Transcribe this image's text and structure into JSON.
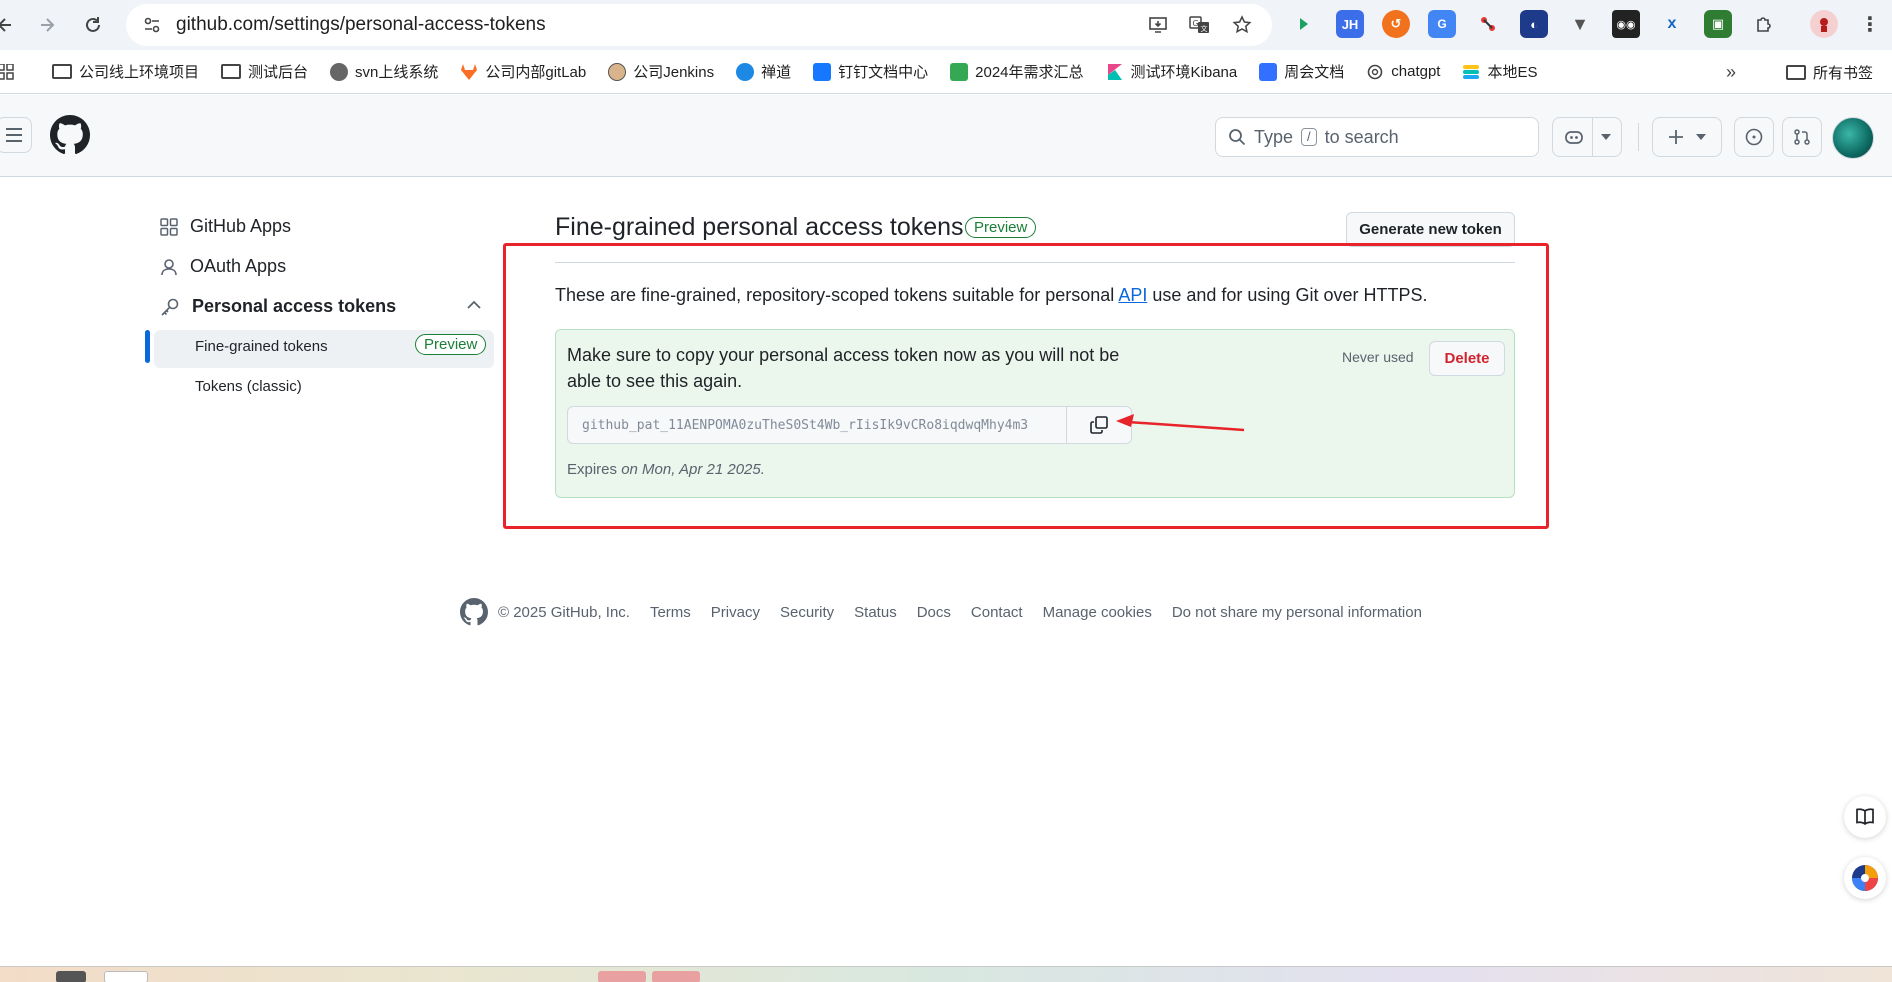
{
  "browser": {
    "url": "github.com/settings/personal-access-tokens",
    "bookmarks": [
      {
        "label": "公司线上环境项目",
        "icon": "folder-icon"
      },
      {
        "label": "测试后台",
        "icon": "folder-icon"
      },
      {
        "label": "svn上线系统",
        "icon": "svn-icon"
      },
      {
        "label": "公司内部gitLab",
        "icon": "gitlab-icon"
      },
      {
        "label": "公司Jenkins",
        "icon": "jenkins-icon"
      },
      {
        "label": "禅道",
        "icon": "zentao-icon"
      },
      {
        "label": "钉钉文档中心",
        "icon": "dingtalk-icon"
      },
      {
        "label": "2024年需求汇总",
        "icon": "sheet-icon"
      },
      {
        "label": "测试环境Kibana",
        "icon": "kibana-icon"
      },
      {
        "label": "周会文档",
        "icon": "doc-icon"
      },
      {
        "label": "chatgpt",
        "icon": "openai-icon"
      },
      {
        "label": "本地ES",
        "icon": "elastic-icon"
      }
    ],
    "all_bookmarks_label": "所有书签",
    "extension_icons": [
      "ext-green",
      "ext-jh",
      "ext-orange",
      "ext-translate",
      "ext-red",
      "ext-blue",
      "ext-v",
      "ext-mask",
      "ext-x",
      "ext-green-box",
      "extensions-icon",
      "profile-icon",
      "menu-icon"
    ]
  },
  "header": {
    "search_placeholder_pre": "Type",
    "search_key": "/",
    "search_placeholder_post": "to search"
  },
  "sidebar": {
    "items": [
      {
        "label": "GitHub Apps",
        "icon": "apps-icon"
      },
      {
        "label": "OAuth Apps",
        "icon": "person-icon"
      },
      {
        "label": "Personal access tokens",
        "icon": "key-icon"
      }
    ],
    "sub_items": [
      {
        "label": "Fine-grained tokens",
        "badge": "Preview",
        "active": true
      },
      {
        "label": "Tokens (classic)",
        "badge": ""
      }
    ]
  },
  "main": {
    "title": "Fine-grained personal access tokens",
    "title_badge": "Preview",
    "generate_button": "Generate new token",
    "description_pre": "These are fine-grained, repository-scoped tokens suitable for personal ",
    "description_link": "API",
    "description_post": " use and for using Git over HTTPS.",
    "token_panel": {
      "warning": "Make sure to copy your personal access token now as you will not be able to see this again.",
      "status": "Never used",
      "delete_button": "Delete",
      "token_value": "github_pat_11AENPOMA0zuTheS0St4Wb_rIisIk9vCRo8iqdwqMhy4m3",
      "expires_prefix": "Expires",
      "expires_date": "on Mon, Apr 21 2025."
    }
  },
  "footer": {
    "copyright": "© 2025 GitHub, Inc.",
    "links": [
      "Terms",
      "Privacy",
      "Security",
      "Status",
      "Docs",
      "Contact",
      "Manage cookies",
      "Do not share my personal information"
    ]
  },
  "colors": {
    "accent_blue": "#0969da",
    "success_green": "#1a7f37",
    "danger_red": "#d1242f",
    "annotation_red": "#e8232a",
    "panel_green_bg": "#ebf6ed"
  }
}
